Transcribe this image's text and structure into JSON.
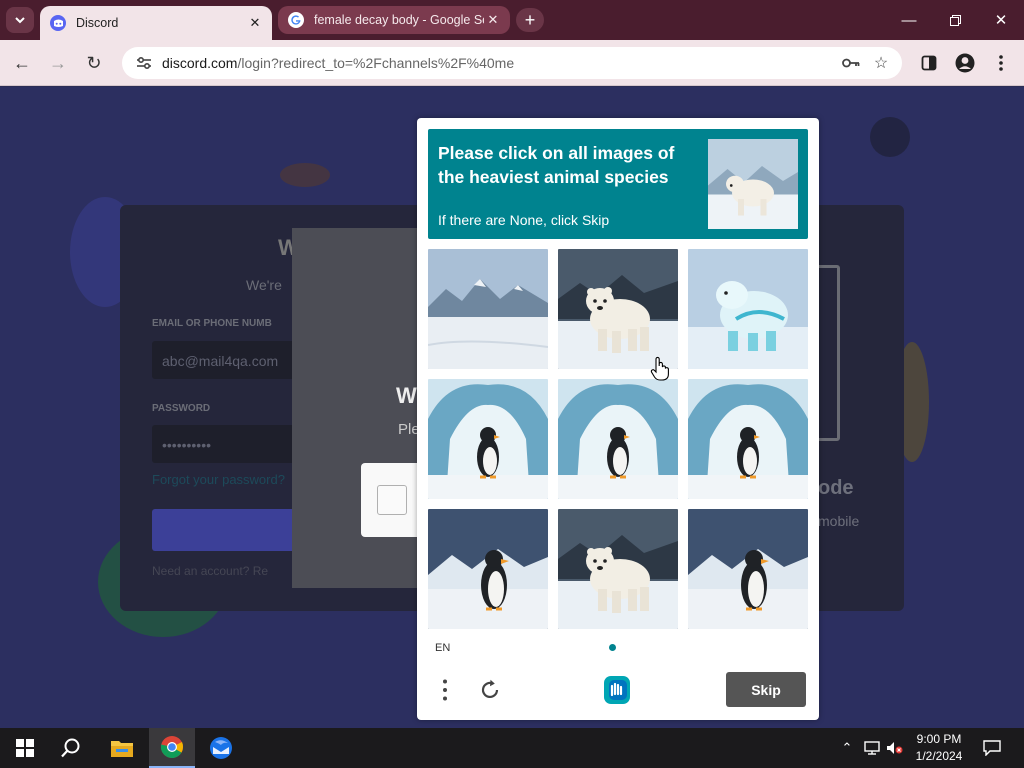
{
  "browser": {
    "tabs": [
      {
        "title": "Discord",
        "active": true,
        "favicon": "discord-icon"
      },
      {
        "title": "female decay body - Google Se",
        "active": false,
        "favicon": "google-icon"
      }
    ],
    "address_host": "discord.com",
    "address_path": "/login?redirect_to=%2Fchannels%2F%40me",
    "icons": [
      "back-icon",
      "forward-icon",
      "reload-icon",
      "site-settings-icon",
      "password-key-icon",
      "bookmark-star-icon",
      "side-panel-icon",
      "profile-icon",
      "menu-icon"
    ]
  },
  "discord_background": {
    "heading_partial": "W",
    "subheading_partial": "We're",
    "email_label": "EMAIL OR PHONE NUMB",
    "email_value": "abc@mail4qa.com",
    "password_label": "PASSWORD",
    "password_value": "••••••••••",
    "forgot_link": "Forgot your password?",
    "register_text": "Need an account? Re",
    "modal_heading_partial": "W",
    "modal_text_partial": "Ple",
    "qr_heading_partial": "ode",
    "qr_text_partial": "mobile"
  },
  "captcha": {
    "prompt_line1": "Please click on all images of",
    "prompt_line2": "the heaviest animal species",
    "hint": "If there are None, click Skip",
    "sample_image": "polar-bear",
    "grid": [
      {
        "subject": "empty-snowfield",
        "label": "empty snowy landscape"
      },
      {
        "subject": "polar-bear",
        "label": "polar bear"
      },
      {
        "subject": "polar-bear-ice",
        "label": "icy polar bear"
      },
      {
        "subject": "penguin-cave",
        "label": "penguin in ice cave"
      },
      {
        "subject": "penguin-cave",
        "label": "penguin in ice cave"
      },
      {
        "subject": "penguin-cave",
        "label": "penguin in ice cave"
      },
      {
        "subject": "penguin",
        "label": "penguin"
      },
      {
        "subject": "polar-bear",
        "label": "polar bear"
      },
      {
        "subject": "penguin",
        "label": "penguin"
      }
    ],
    "language": "EN",
    "skip_label": "Skip",
    "accent_color": "#00838f"
  },
  "taskbar": {
    "time": "9:00 PM",
    "date": "1/2/2024",
    "apps": [
      "windows-start-icon",
      "search-icon",
      "file-explorer-icon",
      "chrome-icon",
      "thunderbird-icon"
    ]
  }
}
